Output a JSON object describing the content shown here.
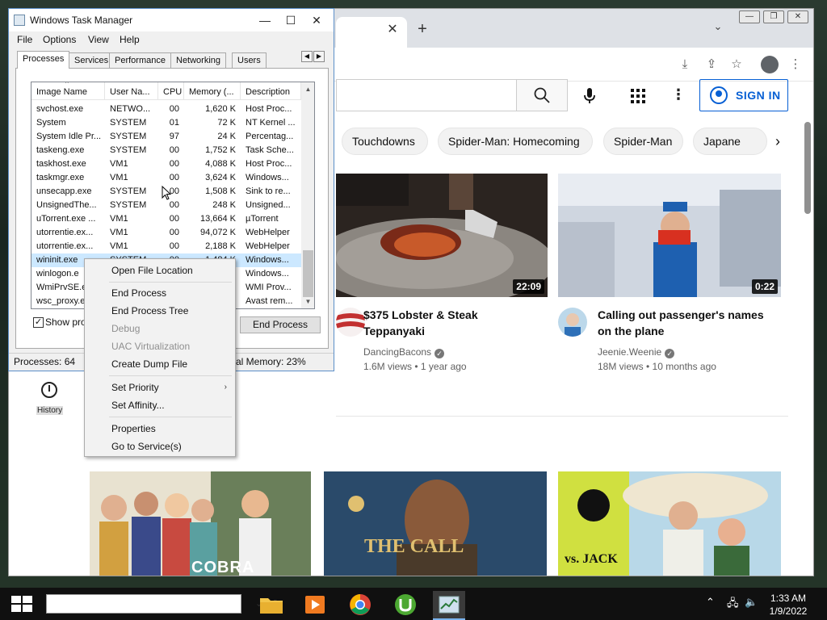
{
  "task_manager": {
    "title": "Windows Task Manager",
    "menu": [
      "File",
      "Options",
      "View",
      "Help"
    ],
    "tabs": [
      "Processes",
      "Services",
      "Performance",
      "Networking",
      "Users"
    ],
    "columns": [
      "Image Name",
      "User Na...",
      "CPU",
      "Memory (...",
      "Description"
    ],
    "rows": [
      {
        "name": "svchost.exe",
        "user": "NETWO...",
        "cpu": "00",
        "mem": "1,620 K",
        "desc": "Host Proc..."
      },
      {
        "name": "System",
        "user": "SYSTEM",
        "cpu": "01",
        "mem": "72 K",
        "desc": "NT Kernel ..."
      },
      {
        "name": "System Idle Pr...",
        "user": "SYSTEM",
        "cpu": "97",
        "mem": "24 K",
        "desc": "Percentag..."
      },
      {
        "name": "taskeng.exe",
        "user": "SYSTEM",
        "cpu": "00",
        "mem": "1,752 K",
        "desc": "Task Sche..."
      },
      {
        "name": "taskhost.exe",
        "user": "VM1",
        "cpu": "00",
        "mem": "4,088 K",
        "desc": "Host Proc..."
      },
      {
        "name": "taskmgr.exe",
        "user": "VM1",
        "cpu": "00",
        "mem": "3,624 K",
        "desc": "Windows..."
      },
      {
        "name": "unsecapp.exe",
        "user": "SYSTEM",
        "cpu": "00",
        "mem": "1,508 K",
        "desc": "Sink to re..."
      },
      {
        "name": "UnsignedThe...",
        "user": "SYSTEM",
        "cpu": "00",
        "mem": "248 K",
        "desc": "Unsigned..."
      },
      {
        "name": "uTorrent.exe ...",
        "user": "VM1",
        "cpu": "00",
        "mem": "13,664 K",
        "desc": "µTorrent"
      },
      {
        "name": "utorrentie.ex...",
        "user": "VM1",
        "cpu": "00",
        "mem": "94,072 K",
        "desc": "WebHelper"
      },
      {
        "name": "utorrentie.ex...",
        "user": "VM1",
        "cpu": "00",
        "mem": "2,188 K",
        "desc": "WebHelper"
      },
      {
        "name": "wininit.exe",
        "user": "SYSTEM",
        "cpu": "00",
        "mem": "1,484 K",
        "desc": "Windows..."
      },
      {
        "name": "winlogon.e",
        "user": "",
        "cpu": "",
        "mem": "",
        "desc": "Windows..."
      },
      {
        "name": "WmiPrvSE.e",
        "user": "",
        "cpu": "",
        "mem": "",
        "desc": "WMI Prov..."
      },
      {
        "name": "wsc_proxy.e",
        "user": "",
        "cpu": "",
        "mem": "",
        "desc": "Avast rem..."
      }
    ],
    "show_processes_label": "Show pro",
    "end_process_label": "End Process",
    "status_processes": "Processes: 64",
    "status_memory": "al Memory: 23%"
  },
  "context_menu": {
    "items": [
      {
        "label": "Open File Location",
        "disabled": false
      },
      {
        "label": "End Process",
        "disabled": false
      },
      {
        "label": "End Process Tree",
        "disabled": false
      },
      {
        "label": "Debug",
        "disabled": true
      },
      {
        "label": "UAC Virtualization",
        "disabled": true
      },
      {
        "label": "Create Dump File",
        "disabled": false
      },
      {
        "label": "Set Priority",
        "disabled": false
      },
      {
        "label": "Set Affinity...",
        "disabled": false
      },
      {
        "label": "Properties",
        "disabled": false
      },
      {
        "label": "Go to Service(s)",
        "disabled": false
      }
    ]
  },
  "youtube": {
    "sign_in": "SIGN IN",
    "chips": [
      "Touchdowns",
      "Spider-Man: Homecoming",
      "Spider-Man",
      "Japane"
    ],
    "videos": [
      {
        "title1": "$375 Lobster & Steak",
        "title2": "Teppanyaki",
        "channel": "DancingBacons",
        "meta": "1.6M views • 1 year ago",
        "duration": "22:09"
      },
      {
        "title1": "Calling out passenger's names",
        "title2": "on the plane",
        "channel": "Jeenie.Weenie",
        "meta": "18M views • 10 months ago",
        "duration": "0:22"
      }
    ],
    "thumb_labels": {
      "cobra": "COBRA",
      "call": "THE CALL",
      "jack": "vs. JACK"
    },
    "sidebar_history": "History"
  },
  "taskbar": {
    "time": "1:33 AM",
    "date": "1/9/2022"
  },
  "colors": {
    "yt_blue": "#065fd4",
    "selection": "#cce8ff"
  }
}
